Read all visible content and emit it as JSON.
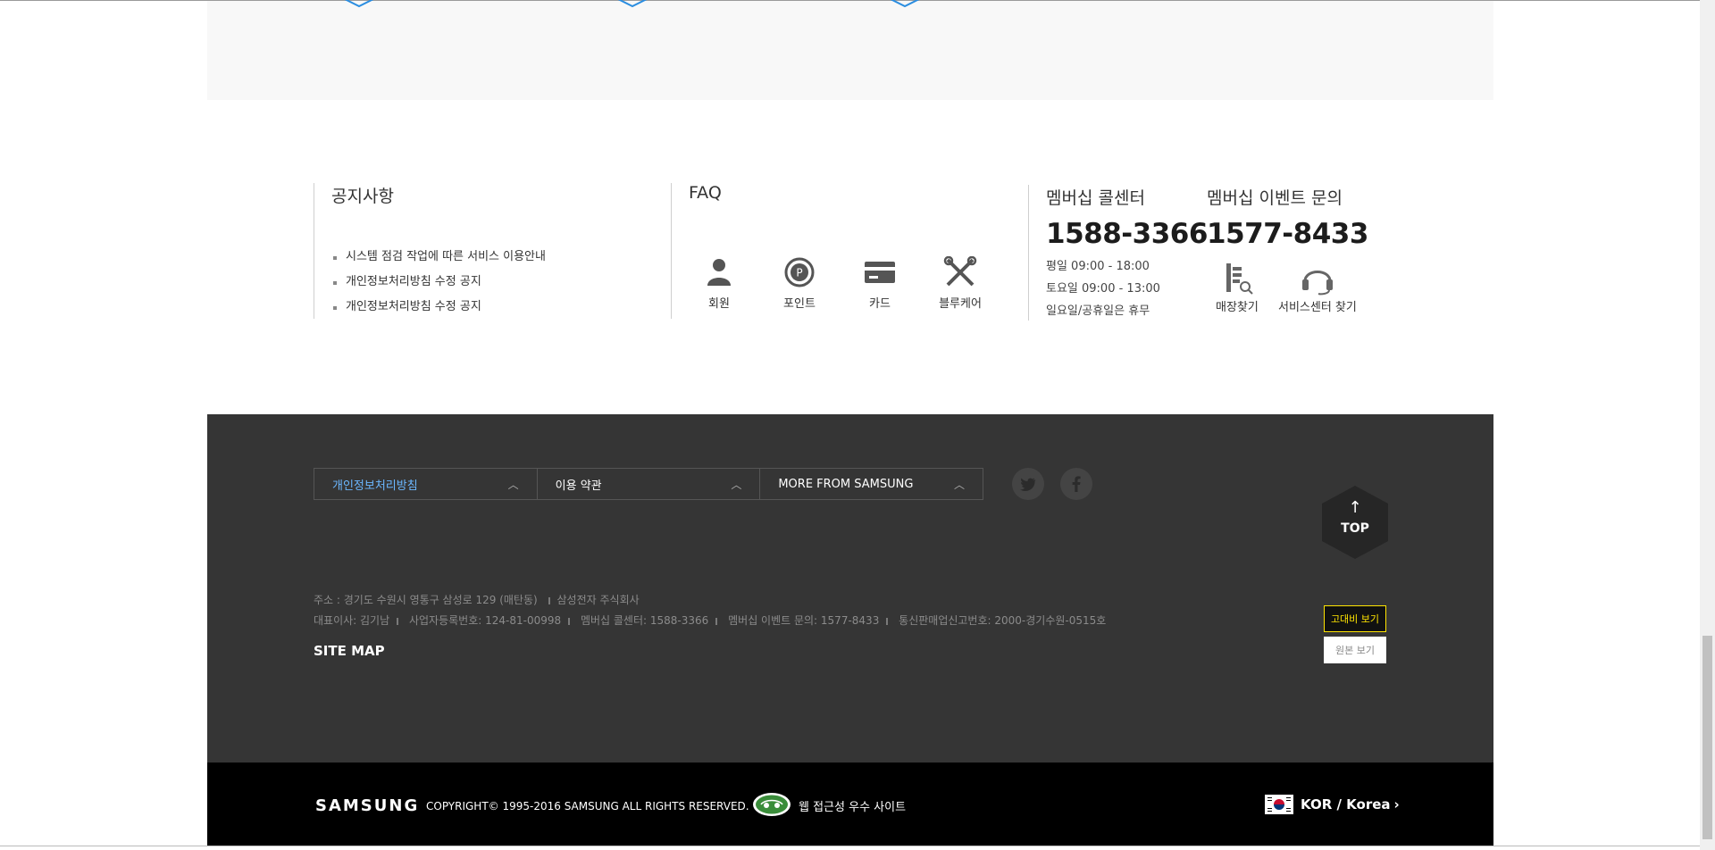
{
  "notice": {
    "title": "공지사항",
    "items": [
      "시스템 점검 작업에 따른 서비스 이용안내",
      "개인정보처리방침 수정 공지",
      "개인정보처리방침 수정 공지"
    ]
  },
  "faq": {
    "title": "FAQ",
    "items": [
      {
        "label": "회원",
        "icon": "person-icon"
      },
      {
        "label": "포인트",
        "icon": "point-icon"
      },
      {
        "label": "카드",
        "icon": "card-icon"
      },
      {
        "label": "블루케어",
        "icon": "tools-icon"
      }
    ]
  },
  "call_center": {
    "title": "멤버십 콜센터",
    "number": "1588-3366",
    "hours": [
      "평일 09:00 - 18:00",
      "토요일 09:00 - 13:00",
      "일요일/공휴일은 휴무"
    ]
  },
  "event_center": {
    "title": "멤버십 이벤트 문의",
    "number": "1577-8433",
    "links": [
      {
        "label": "매장찾기",
        "icon": "store-search-icon"
      },
      {
        "label": "서비스센터 찾기",
        "icon": "headset-icon"
      }
    ]
  },
  "footer": {
    "dropdowns": [
      "개인정보처리방침",
      "이용 약관",
      "MORE FROM SAMSUNG"
    ],
    "address_line": "주소 : 경기도 수원시 영통구 삼성로 129 (매탄동) ",
    "address_company": "삼성전자 주식회사",
    "info_items": [
      "대표이사: 김기남",
      "사업자등록번호: 124-81-00998",
      "멤버십 콜센터: 1588-3366",
      "멤버십 이벤트 문의: 1577-8433",
      "통신판매업신고번호: 2000-경기수원-0515호"
    ],
    "sitemap": "SITE MAP",
    "top_label": "TOP",
    "contrast_label": "고대비 보기",
    "original_label": "원본 보기"
  },
  "bottom": {
    "logo": "SAMSUNG",
    "copyright": "COPYRIGHT© 1995-2016 SAMSUNG ALL RIGHTS RESERVED.",
    "accessibility": "웹 접근성 우수 사이트",
    "language": "KOR / Korea"
  },
  "colors": {
    "dark_footer": "#353535",
    "accent_blue": "#6bb7ff",
    "contrast_yellow": "#ffe400"
  }
}
